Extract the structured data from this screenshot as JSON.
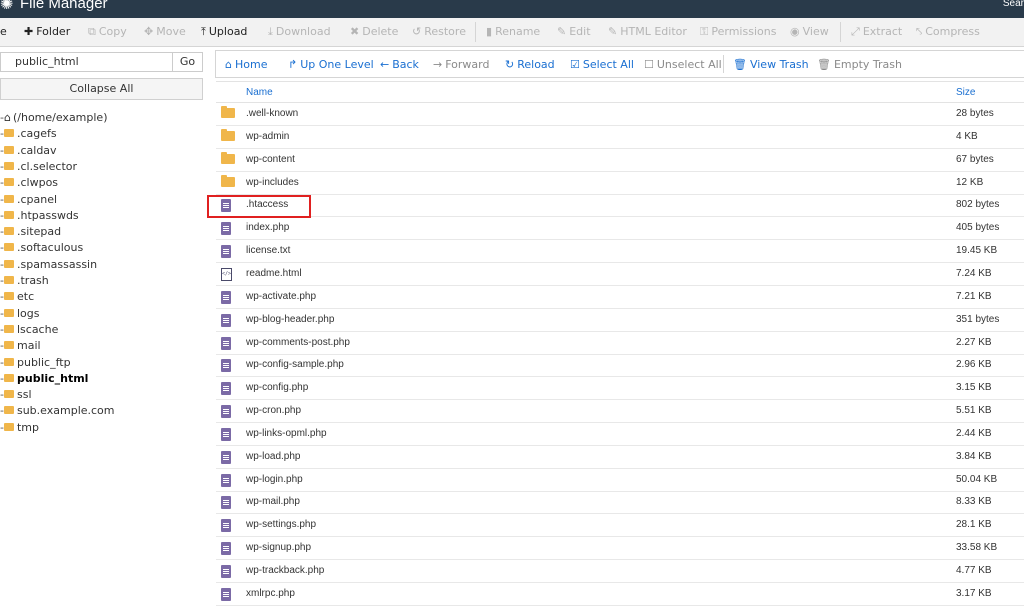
{
  "app": {
    "title": "File Manager",
    "search_label": "Sear"
  },
  "toolbar": {
    "items": [
      {
        "label": "e",
        "icon": "",
        "enabled": true
      },
      {
        "label": "Folder",
        "icon": "plus-icon",
        "enabled": true
      },
      {
        "label": "Copy",
        "icon": "copy-icon",
        "enabled": false
      },
      {
        "label": "Move",
        "icon": "move-icon",
        "enabled": false
      },
      {
        "label": "Upload",
        "icon": "upload-icon",
        "enabled": true
      },
      {
        "label": "Download",
        "icon": "download-icon",
        "enabled": false
      },
      {
        "label": "Delete",
        "icon": "delete-icon",
        "enabled": false
      },
      {
        "label": "Restore",
        "icon": "restore-icon",
        "enabled": false
      },
      {
        "label": "Rename",
        "icon": "rename-icon",
        "enabled": false
      },
      {
        "label": "Edit",
        "icon": "pencil-icon",
        "enabled": false
      },
      {
        "label": "HTML Editor",
        "icon": "html-editor-icon",
        "enabled": false
      },
      {
        "label": "Permissions",
        "icon": "key-icon",
        "enabled": false
      },
      {
        "label": "View",
        "icon": "eye-icon",
        "enabled": false
      },
      {
        "label": "Extract",
        "icon": "extract-icon",
        "enabled": false
      },
      {
        "label": "Compress",
        "icon": "compress-icon",
        "enabled": false
      }
    ]
  },
  "sidebar": {
    "path_value": "public_html",
    "go_label": "Go",
    "collapse_label": "Collapse All",
    "tree": [
      {
        "label": "(/home/example)",
        "type": "home"
      },
      {
        "label": ".cagefs",
        "type": "folder"
      },
      {
        "label": ".caldav",
        "type": "folder"
      },
      {
        "label": ".cl.selector",
        "type": "folder"
      },
      {
        "label": ".clwpos",
        "type": "folder"
      },
      {
        "label": ".cpanel",
        "type": "folder"
      },
      {
        "label": ".htpasswds",
        "type": "folder"
      },
      {
        "label": ".sitepad",
        "type": "folder"
      },
      {
        "label": ".softaculous",
        "type": "folder"
      },
      {
        "label": ".spamassassin",
        "type": "folder"
      },
      {
        "label": ".trash",
        "type": "folder"
      },
      {
        "label": "etc",
        "type": "folder"
      },
      {
        "label": "logs",
        "type": "folder"
      },
      {
        "label": "lscache",
        "type": "folder"
      },
      {
        "label": "mail",
        "type": "folder"
      },
      {
        "label": "public_ftp",
        "type": "folder"
      },
      {
        "label": "public_html",
        "type": "folder",
        "current": true
      },
      {
        "label": "ssl",
        "type": "folder"
      },
      {
        "label": "sub.example.com",
        "type": "folder"
      },
      {
        "label": "tmp",
        "type": "folder"
      }
    ]
  },
  "navbar": {
    "items": [
      {
        "label": "Home",
        "icon": "home-icon",
        "enabled": true
      },
      {
        "label": "Up One Level",
        "icon": "up-level-icon",
        "enabled": true
      },
      {
        "label": "Back",
        "icon": "arrow-left-icon",
        "enabled": true
      },
      {
        "label": "Forward",
        "icon": "arrow-right-icon",
        "enabled": false
      },
      {
        "label": "Reload",
        "icon": "reload-icon",
        "enabled": true
      },
      {
        "label": "Select All",
        "icon": "checkbox-checked-icon",
        "enabled": true
      },
      {
        "label": "Unselect All",
        "icon": "checkbox-empty-icon",
        "enabled": false
      },
      {
        "label": "View Trash",
        "icon": "trash-icon",
        "enabled": true
      },
      {
        "label": "Empty Trash",
        "icon": "trash-icon",
        "enabled": false
      }
    ]
  },
  "table": {
    "columns": {
      "name": "Name",
      "size": "Size"
    },
    "rows": [
      {
        "name": ".well-known",
        "size": "28 bytes",
        "type": "folder"
      },
      {
        "name": "wp-admin",
        "size": "4 KB",
        "type": "folder"
      },
      {
        "name": "wp-content",
        "size": "67 bytes",
        "type": "folder"
      },
      {
        "name": "wp-includes",
        "size": "12 KB",
        "type": "folder"
      },
      {
        "name": ".htaccess",
        "size": "802 bytes",
        "type": "file",
        "highlighted": true
      },
      {
        "name": "index.php",
        "size": "405 bytes",
        "type": "file"
      },
      {
        "name": "license.txt",
        "size": "19.45 KB",
        "type": "file"
      },
      {
        "name": "readme.html",
        "size": "7.24 KB",
        "type": "html"
      },
      {
        "name": "wp-activate.php",
        "size": "7.21 KB",
        "type": "file"
      },
      {
        "name": "wp-blog-header.php",
        "size": "351 bytes",
        "type": "file"
      },
      {
        "name": "wp-comments-post.php",
        "size": "2.27 KB",
        "type": "file"
      },
      {
        "name": "wp-config-sample.php",
        "size": "2.96 KB",
        "type": "file"
      },
      {
        "name": "wp-config.php",
        "size": "3.15 KB",
        "type": "file"
      },
      {
        "name": "wp-cron.php",
        "size": "5.51 KB",
        "type": "file"
      },
      {
        "name": "wp-links-opml.php",
        "size": "2.44 KB",
        "type": "file"
      },
      {
        "name": "wp-load.php",
        "size": "3.84 KB",
        "type": "file"
      },
      {
        "name": "wp-login.php",
        "size": "50.04 KB",
        "type": "file"
      },
      {
        "name": "wp-mail.php",
        "size": "8.33 KB",
        "type": "file"
      },
      {
        "name": "wp-settings.php",
        "size": "28.1 KB",
        "type": "file"
      },
      {
        "name": "wp-signup.php",
        "size": "33.58 KB",
        "type": "file"
      },
      {
        "name": "wp-trackback.php",
        "size": "4.77 KB",
        "type": "file"
      },
      {
        "name": "xmlrpc.php",
        "size": "3.17 KB",
        "type": "file"
      }
    ]
  },
  "colors": {
    "topbar": "#293a4a",
    "link": "#1a6fd1",
    "folder": "#f0b64a",
    "file": "#7b6aa6",
    "highlight": "#e02020"
  }
}
